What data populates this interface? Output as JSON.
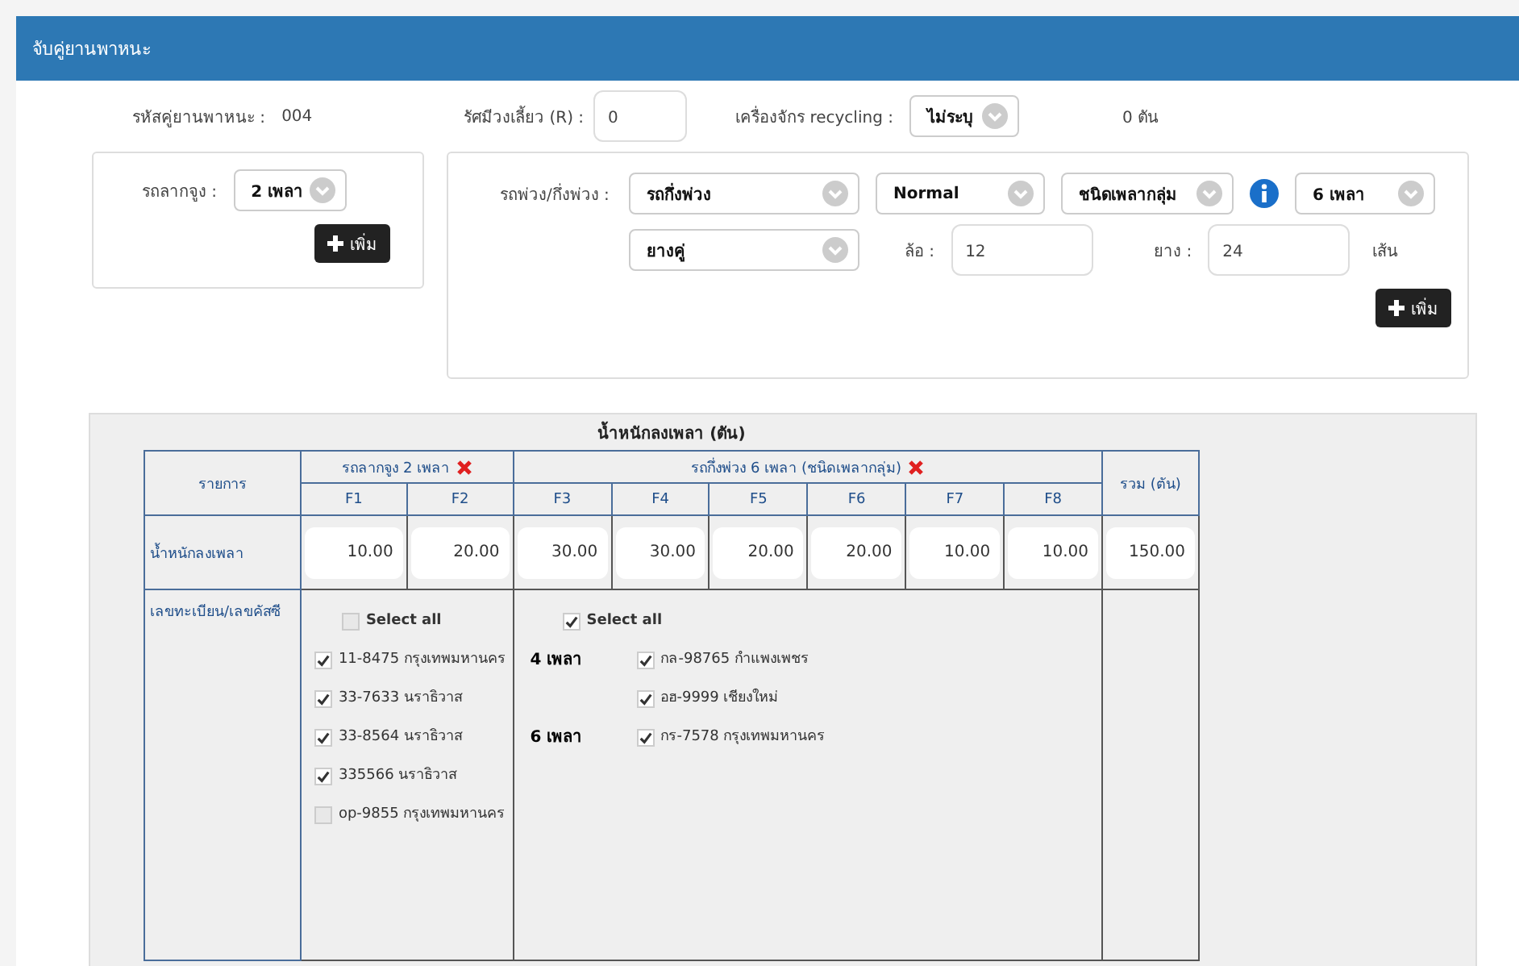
{
  "header": {
    "title": "จับคู่ยานพาหนะ"
  },
  "info": {
    "code_label": "รหัสคู่ยานพาหนะ :",
    "code_value": "004",
    "ratio_label": "รัศมีวงเลี้ยว (R) :",
    "ratio_value": "0",
    "recycling_label": "เครื่องจักร recycling :",
    "recycling_value": "ไม่ระบุ",
    "tons": "0 ตัน"
  },
  "tractor": {
    "label": "รถลากจูง :",
    "select": "2 เพลา",
    "add_button": "เพิ่ม"
  },
  "trailer": {
    "label": "รถพ่วง/กึ่งพ่วง :",
    "selects": [
      "รถกึ่งพ่วง",
      "Normal",
      "ชนิดเพลากลุ่ม"
    ],
    "axle_select": "6 เพลา",
    "tire_select": "ยางคู่",
    "wheel_label": "ล้อ :",
    "wheel_value": "12",
    "tire_label": "ยาง :",
    "tire_value": "24",
    "tire_unit": "เส้น",
    "add_button": "เพิ่ม"
  },
  "table": {
    "title": "น้ำหนักลงเพลา (ตัน)",
    "item_header": "รายการ",
    "total_header": "รวม (ตัน)",
    "groups": [
      {
        "label": "รถลากจูง 2 เพลา",
        "columns": [
          "F1",
          "F2"
        ]
      },
      {
        "label": "รถกึ่งพ่วง 6 เพลา (ชนิดเพลากลุ่ม)",
        "columns": [
          "F3",
          "F4",
          "F5",
          "F6",
          "F7",
          "F8"
        ]
      }
    ],
    "weight_label": "น้ำหนักลงเพลา",
    "weights": [
      "10.00",
      "20.00",
      "30.00",
      "30.00",
      "20.00",
      "20.00",
      "10.00",
      "10.00"
    ],
    "weight_total": "150.00",
    "plates_label": "เลขทะเบียน/เลขคัสซี",
    "plate_groups": [
      {
        "select_all": "Select all",
        "checked": false,
        "sections": [
          {
            "items": [
              {
                "text": "11-8475 กรุงเทพมหานคร",
                "checked": true
              },
              {
                "text": "33-7633 นราธิวาส",
                "checked": true
              },
              {
                "text": "33-8564 นราธิวาส",
                "checked": true
              },
              {
                "text": "335566 นราธิวาส",
                "checked": true
              },
              {
                "text": "op-9855 กรุงเทพมหานคร",
                "checked": false
              }
            ]
          }
        ]
      },
      {
        "select_all": "Select all",
        "checked": true,
        "sections": [
          {
            "axle": "4 เพลา",
            "items": [
              {
                "text": "กล-98765 กำแพงเพชร",
                "checked": true
              },
              {
                "text": "อฮ-9999 เชียงใหม่",
                "checked": true
              }
            ]
          },
          {
            "axle": "6 เพลา",
            "items": [
              {
                "text": "กร-7578 กรุงเทพมหานคร",
                "checked": true
              }
            ]
          }
        ]
      }
    ]
  }
}
